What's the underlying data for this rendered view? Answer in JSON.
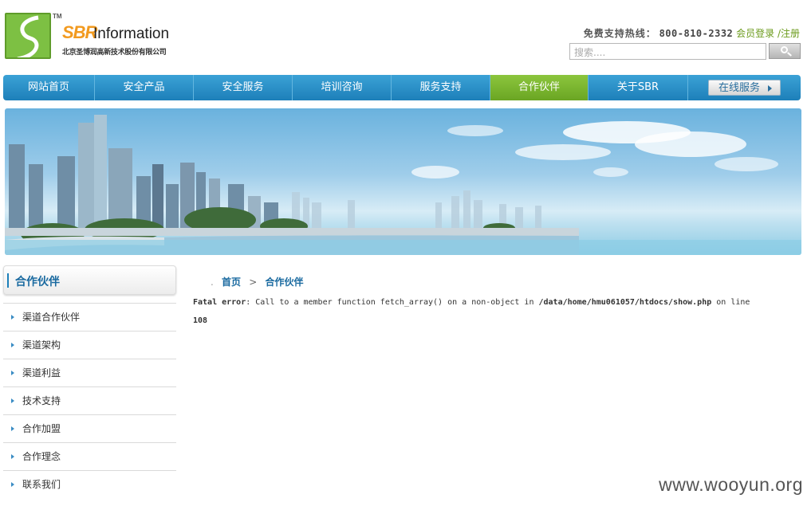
{
  "logo": {
    "tm": "TM",
    "brand_sbr": "SBR",
    "brand_info": "Information",
    "company_cn": "北京圣博润高新技术股份有限公司"
  },
  "header": {
    "hotline_label": "免费支持热线：",
    "hotline_number": "800-810-2332",
    "login": "会员登录",
    "register": "/注册",
    "search_placeholder": "搜索....",
    "accent_color": "#6a9a1a"
  },
  "nav": {
    "items": [
      {
        "label": "网站首页"
      },
      {
        "label": "安全产品"
      },
      {
        "label": "安全服务"
      },
      {
        "label": "培训咨询"
      },
      {
        "label": "服务支持"
      },
      {
        "label": "合作伙伴"
      },
      {
        "label": "关于SBR"
      }
    ],
    "active_index": 5,
    "online_button": "在线服务",
    "colors": {
      "bar": "#1d7fb9",
      "active": "#7ab62e"
    }
  },
  "sidebar": {
    "title": "合作伙伴",
    "items": [
      {
        "label": "渠道合作伙伴"
      },
      {
        "label": "渠道架构"
      },
      {
        "label": "渠道利益"
      },
      {
        "label": "技术支持"
      },
      {
        "label": "合作加盟"
      },
      {
        "label": "合作理念"
      },
      {
        "label": "联系我们"
      }
    ]
  },
  "breadcrumb": {
    "lead": ".",
    "home": "首页",
    "separator": ">",
    "current": "合作伙伴"
  },
  "error": {
    "label": "Fatal error",
    "message": ": Call to a member function fetch_array() on a non-object in ",
    "path": "/data/home/hmu061057/htdocs/show.php",
    "online": " on line ",
    "line": "108"
  },
  "watermark": "www.wooyun.org"
}
